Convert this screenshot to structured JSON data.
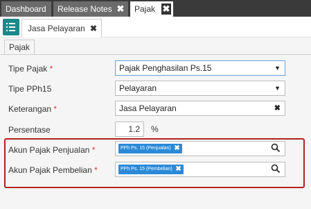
{
  "top_tabs": [
    {
      "label": "Dashboard"
    },
    {
      "label": "Release Notes",
      "close": "✖"
    },
    {
      "label": "Pajak",
      "close": "✖"
    }
  ],
  "sub_tab": {
    "label": "Jasa Pelayaran",
    "close": "✖"
  },
  "inner_tab": {
    "label": "Pajak"
  },
  "form": {
    "tipe_pajak": {
      "label": "Tipe Pajak",
      "required": "*",
      "value": "Pajak Penghasilan Ps.15",
      "caret": "▼"
    },
    "tipe_pph15": {
      "label": "Tipe PPh15",
      "value": "Pelayaran",
      "caret": "▼"
    },
    "keterangan": {
      "label": "Keterangan",
      "required": "*",
      "value": "Jasa Pelayaran",
      "clear": "✖"
    },
    "persentase": {
      "label": "Persentase",
      "value": "1.2",
      "unit": "%"
    },
    "akun_penjualan": {
      "label": "Akun Pajak Penjualan",
      "required": "*",
      "chip": "PPh Ps. 15 (Penjualan)",
      "chip_close": "✖"
    },
    "akun_pembelian": {
      "label": "Akun Pajak Pembelian",
      "required": "*",
      "chip": "PPh Ps. 15 (Pembelian)",
      "chip_close": "✖"
    }
  },
  "colors": {
    "accent": "#1a8a8a",
    "chip": "#2a8ad8",
    "highlight": "#b22222",
    "dark_bar": "#3a3a3a"
  },
  "icons": {
    "menu": "list-menu-icon",
    "search": "search-icon"
  }
}
